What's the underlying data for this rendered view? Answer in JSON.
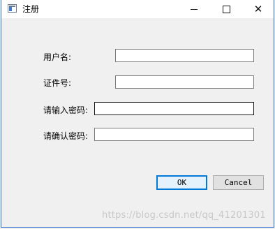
{
  "window": {
    "title": "注册",
    "min_icon": "minimize-icon",
    "max_icon": "maximize-icon",
    "close_icon": "close-icon",
    "close_glyph": "✕"
  },
  "form": {
    "username_label": "用户名:",
    "username_value": "",
    "id_label": "证件号:",
    "id_value": "",
    "password_label": "请输入密码:",
    "password_value": "",
    "confirm_label": "请确认密码:",
    "confirm_value": ""
  },
  "buttons": {
    "ok_label": "OK",
    "cancel_label": "Cancel"
  },
  "watermark": "https://blog.csdn.net/qq_41201301",
  "colors": {
    "accent": "#0078d7",
    "background": "#f0f0f0"
  }
}
